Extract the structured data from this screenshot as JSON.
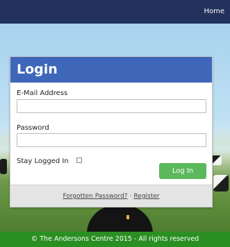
{
  "nav": {
    "home_label": "Home"
  },
  "login": {
    "title": "Login",
    "email_label": "E-Mail Address",
    "email_value": "",
    "password_label": "Password",
    "password_value": "",
    "remember_label": "Stay Logged In",
    "remember_checked": false,
    "submit_label": "Log In",
    "forgot_link": "Forgotten Password?",
    "separator": "·",
    "register_link": "Register"
  },
  "footer": {
    "copyright": "© The Andersons Centre 2015 - All rights reserved"
  },
  "colors": {
    "topbar": "#22325d",
    "header": "#3e67b9",
    "button": "#5cb85c",
    "footer": "#2a8f22"
  }
}
